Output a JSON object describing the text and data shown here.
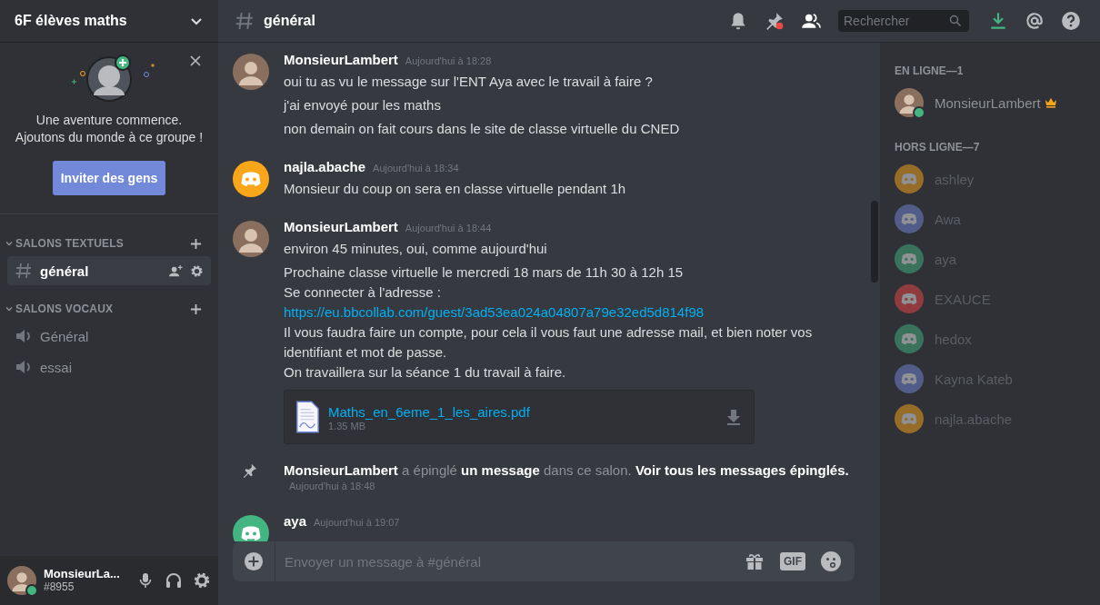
{
  "server": {
    "name": "6F élèves maths"
  },
  "invite_card": {
    "lines": [
      "Une aventure commence.",
      "Ajoutons du monde à ce groupe !"
    ],
    "button": "Inviter des gens"
  },
  "channel_groups": [
    {
      "label": "SALONS TEXTUELS",
      "channels": [
        {
          "name": "général",
          "kind": "text",
          "selected": true
        }
      ]
    },
    {
      "label": "SALONS VOCAUX",
      "channels": [
        {
          "name": "Général",
          "kind": "voice",
          "selected": false
        },
        {
          "name": "essai",
          "kind": "voice",
          "selected": false
        }
      ]
    }
  ],
  "user_panel": {
    "name": "MonsieurLa...",
    "tag": "#8955",
    "avatar": {
      "kind": "photo"
    },
    "online": true
  },
  "header": {
    "channel": "général",
    "search_placeholder": "Rechercher"
  },
  "messages": [
    {
      "kind": "message",
      "author": "MonsieurLambert",
      "time": "Aujourd'hui à 18:28",
      "avatar": {
        "kind": "photo"
      },
      "blocks": [
        [
          {
            "kind": "text",
            "text": "oui tu as vu le message sur l'ENT Aya avec le travail à faire ?"
          }
        ],
        [
          {
            "kind": "text",
            "text": "j'ai envoyé pour les maths"
          }
        ],
        [
          {
            "kind": "text",
            "text": "non demain on fait cours dans le site de classe virtuelle du CNED"
          }
        ]
      ]
    },
    {
      "kind": "message",
      "author": "najla.abache",
      "time": "Aujourd'hui à 18:34",
      "avatar": {
        "kind": "default",
        "color": "#faa61a"
      },
      "blocks": [
        [
          {
            "kind": "text",
            "text": "Monsieur du coup on sera en classe virtuelle pendant 1h"
          }
        ]
      ]
    },
    {
      "kind": "message",
      "author": "MonsieurLambert",
      "time": "Aujourd'hui à 18:44",
      "avatar": {
        "kind": "photo"
      },
      "blocks": [
        [
          {
            "kind": "text",
            "text": "environ 45 minutes, oui, comme aujourd'hui"
          }
        ],
        [
          {
            "kind": "text",
            "text": "Prochaine classe virtuelle le mercredi 18 mars de 11h 30 à 12h 15"
          },
          {
            "kind": "text",
            "text": "Se connecter à l'adresse :"
          },
          {
            "kind": "link",
            "text": "https://eu.bbcollab.com/guest/3ad53ea024a04807a79e32ed5d814f98"
          },
          {
            "kind": "text",
            "text": "Il vous faudra faire un compte, pour cela il vous faut une adresse mail, et bien noter vos"
          },
          {
            "kind": "text",
            "text": "identifiant et mot de passe."
          },
          {
            "kind": "text",
            "text": "On travaillera sur la séance 1 du travail à faire."
          }
        ]
      ],
      "attachment": {
        "name": "Maths_en_6eme_1_les_aires.pdf",
        "size": "1.35 MB"
      }
    },
    {
      "kind": "system",
      "time": "Aujourd'hui à 18:48",
      "parts": [
        {
          "text": "MonsieurLambert",
          "strong": true
        },
        {
          "text": " a épinglé ",
          "strong": false
        },
        {
          "text": "un message",
          "strong": true
        },
        {
          "text": " dans ce salon. ",
          "strong": false
        },
        {
          "text": "Voir tous les messages épinglés.",
          "strong": true
        }
      ]
    },
    {
      "kind": "message",
      "author": "aya",
      "time": "Aujourd'hui à 19:07",
      "avatar": {
        "kind": "default",
        "color": "#43b581"
      }
    }
  ],
  "composer": {
    "placeholder": "Envoyer un message à #général",
    "gif": "GIF"
  },
  "member_groups": [
    {
      "label": "EN LIGNE—1",
      "members": [
        {
          "name": "MonsieurLambert",
          "avatar": {
            "kind": "photo"
          },
          "online": true,
          "owner": true
        }
      ]
    },
    {
      "label": "HORS LIGNE—7",
      "members": [
        {
          "name": "ashley",
          "avatar": {
            "kind": "default",
            "color": "#956c28"
          },
          "online": false,
          "owner": false
        },
        {
          "name": "Awa",
          "avatar": {
            "kind": "default",
            "color": "#515d88"
          },
          "online": false,
          "owner": false
        },
        {
          "name": "aya",
          "avatar": {
            "kind": "default",
            "color": "#39735c"
          },
          "online": false,
          "owner": false
        },
        {
          "name": "EXAUCE",
          "avatar": {
            "kind": "default",
            "color": "#903c3f"
          },
          "online": false,
          "owner": false
        },
        {
          "name": "hedox",
          "avatar": {
            "kind": "default",
            "color": "#39735c"
          },
          "online": false,
          "owner": false
        },
        {
          "name": "Kayna Kateb",
          "avatar": {
            "kind": "default",
            "color": "#515d88"
          },
          "online": false,
          "owner": false
        },
        {
          "name": "najla.abache",
          "avatar": {
            "kind": "default",
            "color": "#956c28"
          },
          "online": false,
          "owner": false
        }
      ]
    }
  ]
}
